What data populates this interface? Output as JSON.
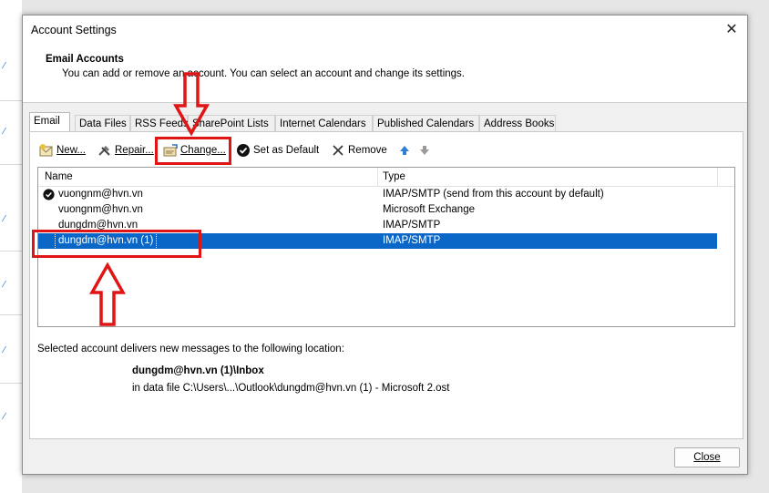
{
  "window": {
    "title": "Account Settings",
    "close_glyph": "✕"
  },
  "header": {
    "title": "Email Accounts",
    "description": "You can add or remove an account. You can select an account and change its settings."
  },
  "tabs": [
    {
      "label": "Email",
      "active": true
    },
    {
      "label": "Data Files"
    },
    {
      "label": "RSS Feeds"
    },
    {
      "label": "SharePoint Lists"
    },
    {
      "label": "Internet Calendars"
    },
    {
      "label": "Published Calendars"
    },
    {
      "label": "Address Books"
    }
  ],
  "toolbar": {
    "new_label": "New...",
    "repair_label": "Repair...",
    "change_label": "Change...",
    "default_label": "Set as Default",
    "remove_label": "Remove",
    "icons": {
      "new": "new-mail-icon",
      "repair": "tools-icon",
      "change": "change-icon",
      "default": "check-circle-icon",
      "remove": "x-icon",
      "up": "arrow-up-icon",
      "down": "arrow-down-icon"
    }
  },
  "list": {
    "columns": [
      "Name",
      "Type"
    ],
    "rows": [
      {
        "name": "vuongnm@hvn.vn",
        "type": "IMAP/SMTP (send from this account by default)",
        "default": true
      },
      {
        "name": "vuongnm@hvn.vn",
        "type": "Microsoft Exchange"
      },
      {
        "name": "dungdm@hvn.vn",
        "type": "IMAP/SMTP"
      },
      {
        "name": "dungdm@hvn.vn (1)",
        "type": "IMAP/SMTP",
        "selected": true
      }
    ]
  },
  "delivery": {
    "label": "Selected account delivers new messages to the following location:",
    "folder": "dungdm@hvn.vn (1)\\Inbox",
    "file": "in data file C:\\Users\\...\\Outlook\\dungdm@hvn.vn (1) - Microsoft 2.ost"
  },
  "footer": {
    "close_label": "Close"
  },
  "colors": {
    "annotation": "#e01515",
    "selection": "#0a67c8"
  }
}
